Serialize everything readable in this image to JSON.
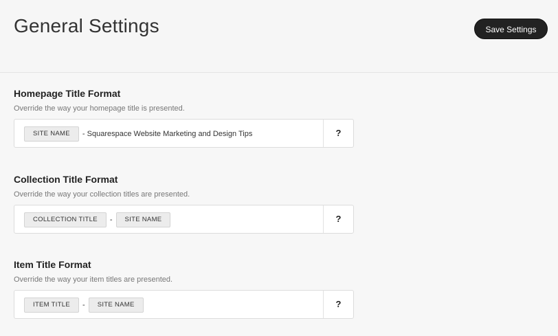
{
  "header": {
    "title": "General Settings",
    "save_label": "Save Settings"
  },
  "sections": [
    {
      "title": "Homepage Title Format",
      "description": "Override the way your homepage title is presented.",
      "tokens": [
        "SITE NAME"
      ],
      "literal": "- Squarespace Website Marketing and Design Tips",
      "help": "?"
    },
    {
      "title": "Collection Title Format",
      "description": "Override the way your collection titles are presented.",
      "tokens": [
        "COLLECTION TITLE",
        "SITE NAME"
      ],
      "separator": "-",
      "help": "?"
    },
    {
      "title": "Item Title Format",
      "description": "Override the way your item titles are presented.",
      "tokens": [
        "ITEM TITLE",
        "SITE NAME"
      ],
      "separator": "-",
      "help": "?"
    }
  ],
  "colors": {
    "background": "#f6f6f6",
    "button": "#222222",
    "token_bg": "#ececec"
  }
}
